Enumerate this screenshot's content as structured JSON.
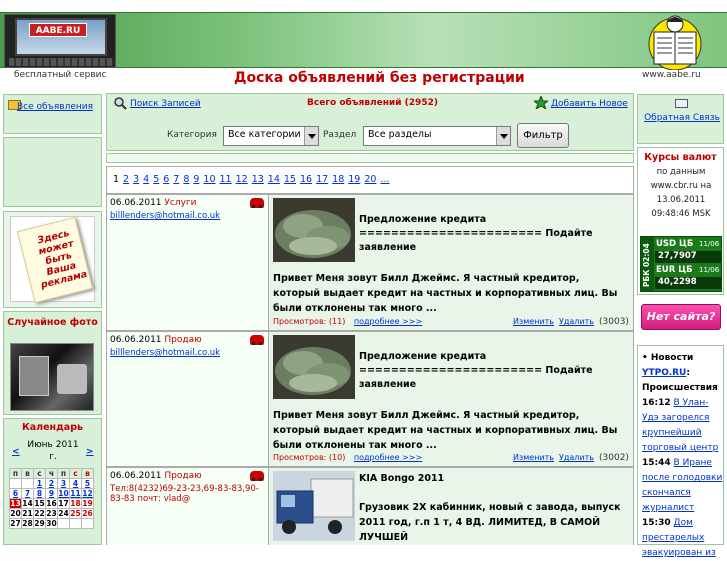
{
  "header": {
    "logo_text": "AABE.RU",
    "sub_left": "бесплатный сервис",
    "title": "Доска объявлений без регистрации",
    "sub_right": "www.aabe.ru"
  },
  "left": {
    "all_ads": "Все объявления",
    "ad_text": "Здесь может быть Ваша реклама",
    "random_photo": "Случайное фото",
    "calendar": {
      "title": "Календарь",
      "month": "Июнь 2011 г.",
      "prev": "<",
      "next": ">",
      "weekdays": [
        "п",
        "в",
        "с",
        "ч",
        "п",
        "с",
        "в"
      ],
      "rows": [
        [
          "",
          "",
          "1",
          "2",
          "3",
          "4",
          "5"
        ],
        [
          "6",
          "7",
          "8",
          "9",
          "10",
          "11",
          "12"
        ],
        [
          "13",
          "14",
          "15",
          "16",
          "17",
          "18",
          "19"
        ],
        [
          "20",
          "21",
          "22",
          "23",
          "24",
          "25",
          "26"
        ],
        [
          "27",
          "28",
          "29",
          "30",
          "",
          "",
          ""
        ]
      ]
    }
  },
  "center": {
    "search_link": "Поиск Записей",
    "total": "Всего объявлений (2952)",
    "add_link": "Добавить Новое",
    "category_label": "Категория",
    "category_value": "Все категории",
    "section_label": "Раздел",
    "section_value": "Все разделы",
    "filter_button": "Фильтр",
    "pages": [
      "1",
      "2",
      "3",
      "4",
      "5",
      "6",
      "7",
      "8",
      "9",
      "10",
      "11",
      "12",
      "13",
      "14",
      "15",
      "16",
      "17",
      "18",
      "19",
      "20",
      "..."
    ],
    "listings": [
      {
        "date": "06.06.2011",
        "type": "Услуги",
        "contact": "billlenders@hotmail.co.uk",
        "title": "Предложение кредита ======================= Подайте заявление",
        "body": "Привет Меня зовут Билл Джеймс. Я частный кредитор, который выдает кредит на частных и корпоративных лиц. Вы были отклонены так много ...",
        "views": "Просмотров: (11)",
        "more": "подробнее >>>",
        "edit": "Изменить",
        "delete": "Удалить",
        "id": "(3003)"
      },
      {
        "date": "06.06.2011",
        "type": "Продаю",
        "contact": "billlenders@hotmail.co.uk",
        "title": "Предложение кредита ======================= Подайте заявление",
        "body": "Привет Меня зовут Билл Джеймс. Я частный кредитор, который выдает кредит на частных и корпоративных лиц. Вы были отклонены так много ...",
        "views": "Просмотров: (10)",
        "more": "подробнее >>>",
        "edit": "Изменить",
        "delete": "Удалить",
        "id": "(3002)"
      },
      {
        "date": "06.06.2011",
        "type": "Продаю",
        "contact": "Тел:8(4232)69-23-23,69-83-83,90-83-83 почт: vlad@",
        "title": "KIA Bongo 2011",
        "body": "Грузовик 2Х кабинник, новый с завода, выпуск 2011 год, г.п 1 т, 4 ВД. ЛИМИТЕД, В САМОЙ ЛУЧШЕЙ"
      }
    ]
  },
  "right": {
    "feedback": "Обратная Связь",
    "rates_title": "Курсы валют",
    "rates_src": "по данным www.cbr.ru на 13.06.2011 09:48:46 MSK",
    "usd_label": "USD ЦБ",
    "usd_date": "11/06",
    "usd_value": "27,7907",
    "eur_label": "EUR ЦБ",
    "eur_date": "11/06",
    "eur_value": "40,2298",
    "rbk": "РБК 02:04",
    "no_site": "Нет сайта?",
    "news_head": "Новости",
    "news_site": "YTPO.RU",
    "news_sub": "Происшествия",
    "news": [
      {
        "time": "16:12",
        "text": "В Улан-Удэ загорелся крупнейший торговый центр"
      },
      {
        "time": "15:44",
        "text": "В Иране после голодовки скончался журналист"
      },
      {
        "time": "15:30",
        "text": "Дом престарелых эвакуирован из"
      }
    ]
  },
  "colors": {
    "accent": "#c00000",
    "link": "#0033cc",
    "panel": "#d8f0d8"
  }
}
